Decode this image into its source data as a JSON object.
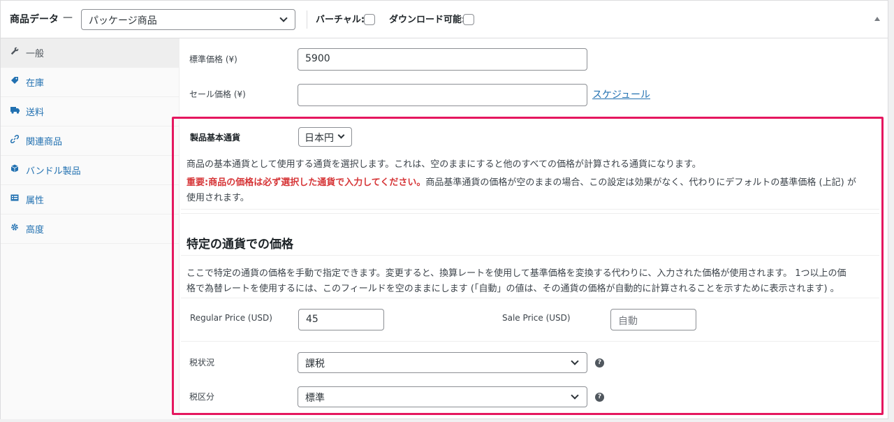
{
  "header": {
    "title": "商品データ",
    "separator": "—",
    "product_type": "パッケージ商品",
    "virtual_label": "バーチャル:",
    "downloadable_label": "ダウンロード可能:"
  },
  "sidebar": {
    "items": [
      {
        "label": "一般",
        "icon": "wrench-icon"
      },
      {
        "label": "在庫",
        "icon": "tag-icon"
      },
      {
        "label": "送料",
        "icon": "truck-icon"
      },
      {
        "label": "関連商品",
        "icon": "link-icon"
      },
      {
        "label": "バンドル製品",
        "icon": "cube-icon"
      },
      {
        "label": "属性",
        "icon": "list-icon"
      },
      {
        "label": "高度",
        "icon": "gear-icon"
      }
    ]
  },
  "general": {
    "regular_price_label": "標準価格 (¥)",
    "regular_price_value": "5900",
    "sale_price_label": "セール価格 (¥)",
    "sale_price_value": "",
    "schedule_link": "スケジュール"
  },
  "currency": {
    "base_currency_label": "製品基本通貨",
    "base_currency_value": "日本円",
    "description": "商品の基本通貨として使用する通貨を選択します。これは、空のままにすると他のすべての価格が計算される通貨になります。",
    "important": "重要:商品の価格は必ず選択した通貨で入力してください。",
    "important_rest_line1": "商品基準通貨の価格が空のままの場合、この設定は効果がなく、代わりにデフォルトの基準価格 (上記) が",
    "important_rest_line2": "使用されます。",
    "section_title": "特定の通貨での価格",
    "section_desc_line1": "ここで特定の通貨の価格を手動で指定できます。変更すると、換算レートを使用して基準価格を変換する代わりに、入力された価格が使用されます。 1つ以上の価",
    "section_desc_line2": "格で為替レートを使用するには、このフィールドを空のままにします (「自動」の値は、その通貨の価格が自動的に計算されることを示すために表示されます) 。",
    "usd_regular_label": "Regular Price (USD)",
    "usd_regular_value": "45",
    "usd_sale_label": "Sale Price (USD)",
    "usd_sale_placeholder": "自動"
  },
  "tax": {
    "status_label": "税状況",
    "status_value": "課税",
    "class_label": "税区分",
    "class_value": "標準"
  },
  "colors": {
    "highlight": "#e5175f",
    "link": "#2271b1",
    "important": "#d63638"
  }
}
